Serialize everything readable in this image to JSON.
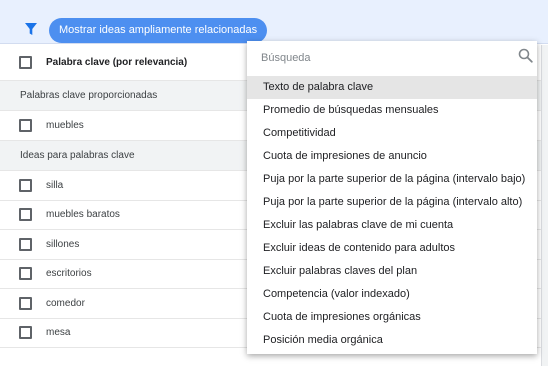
{
  "filter_bar": {
    "chip_label": "Mostrar ideas ampliamente relacionadas"
  },
  "table": {
    "header": {
      "column_label": "Palabra clave (por relevancia)",
      "sort_indicator": "↓"
    },
    "groups": [
      {
        "label": "Palabras clave proporcionadas",
        "rows": [
          "muebles"
        ]
      },
      {
        "label": "Ideas para palabras clave",
        "rows": [
          "silla",
          "muebles baratos",
          "sillones",
          "escritorios",
          "comedor",
          "mesa"
        ]
      }
    ]
  },
  "dropdown": {
    "search_placeholder": "Búsqueda",
    "items": [
      "Texto de palabra clave",
      "Promedio de búsquedas mensuales",
      "Competitividad",
      "Cuota de impresiones de anuncio",
      "Puja por la parte superior de la página (intervalo bajo)",
      "Puja por la parte superior de la página (intervalo alto)",
      "Excluir las palabras clave de mi cuenta",
      "Excluir ideas de contenido para adultos",
      "Excluir palabras claves del plan",
      "Competencia (valor indexado)",
      "Cuota de impresiones orgánicas",
      "Posición media orgánica"
    ],
    "active_item": "Texto de palabra clave"
  },
  "colors": {
    "filter_bar_bg": "#e8f0fe",
    "accent": "#1a73e8",
    "chip_bg": "#4d8ff0",
    "group_row_bg": "#f1f3f4",
    "menu_active_bg": "#e5e5e5"
  },
  "icons": {
    "filter": "filter-icon",
    "search": "search-icon",
    "sort": "arrow-down-icon"
  }
}
